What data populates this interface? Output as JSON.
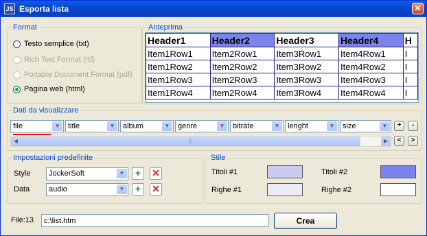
{
  "window": {
    "title": "Esporta lista",
    "app_icon": "JS",
    "close_glyph": "✕"
  },
  "format": {
    "legend": "Format",
    "options": [
      {
        "label": "Testo semplice (txt)",
        "enabled": true,
        "checked": false
      },
      {
        "label": "Rich Text Format (rtf)",
        "enabled": false,
        "checked": false
      },
      {
        "label": "Portable Document Format (pdf)",
        "enabled": false,
        "checked": false
      },
      {
        "label": "Pagina web (html)",
        "enabled": true,
        "checked": true
      }
    ]
  },
  "preview": {
    "legend": "Anteprima",
    "headers": [
      "Header1",
      "Header2",
      "Header3",
      "Header4",
      "H"
    ],
    "header_colors": [
      "#ffffff",
      "#7b84ee",
      "#ffffff",
      "#7b84ee",
      "#ffffff"
    ],
    "rows": [
      [
        "Item1Row1",
        "Item2Row1",
        "Item3Row1",
        "Item4Row1",
        "I"
      ],
      [
        "Item1Row2",
        "Item2Row2",
        "Item3Row2",
        "Item4Row2",
        "I"
      ],
      [
        "Item1Row3",
        "Item2Row3",
        "Item3Row3",
        "Item4Row3",
        "I"
      ],
      [
        "Item1Row4",
        "Item2Row4",
        "Item3Row4",
        "Item4Row4",
        "I"
      ]
    ]
  },
  "fields": {
    "legend": "Dati da visualizzare",
    "columns": [
      "file",
      "title",
      "album",
      "genre",
      "bitrate",
      "lenght",
      "size"
    ],
    "add_label": "+",
    "remove_label": "-",
    "scroll_left": "<",
    "scroll_right": ">",
    "scrollbar_thumb_grip": "|||"
  },
  "presets": {
    "legend": "Impostazioni predefinite",
    "style_label": "Style",
    "style_value": "JockerSoft",
    "data_label": "Data",
    "data_value": "audio",
    "add_glyph": "+",
    "delete_glyph": "✕"
  },
  "stile": {
    "legend": "Stile",
    "titoli1_label": "Titoli #1",
    "titoli2_label": "Titoli #2",
    "righe1_label": "Righe #1",
    "righe2_label": "Righe #2",
    "colors": {
      "titoli1": "#c8cbf2",
      "titoli2": "#7b84ee",
      "righe1": "#ecebf6",
      "righe2": "#ffffff"
    }
  },
  "footer": {
    "file_label": "File:13",
    "path": "c:\\list.htm",
    "create_label": "Crea"
  },
  "icons": {
    "dropdown": "dropdown-arrow-icon",
    "scroll_left": "scroll-left-icon",
    "scroll_right": "scroll-right-icon"
  }
}
